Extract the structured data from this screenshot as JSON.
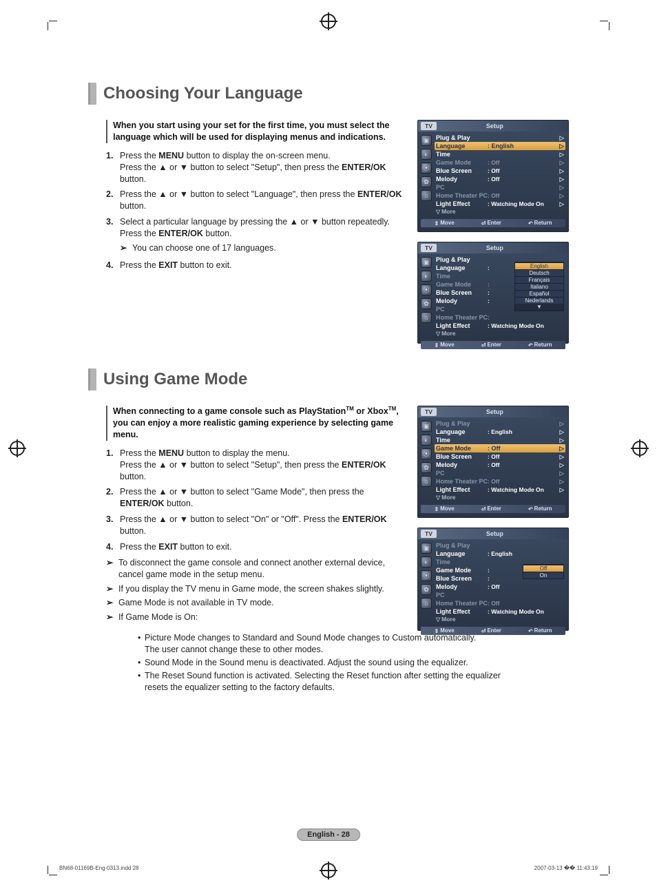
{
  "sec1": {
    "title": "Choosing Your Language",
    "lead": "When you start using your set for the first time, you must select the language which will be used for displaying menus and indications.",
    "steps": {
      "1": {
        "l1": "Press the ",
        "b1": "MENU",
        "l2": " button to display the on-screen menu.",
        "nl": "Press the ▲ or ▼ button to select \"Setup\", then press the ",
        "b2": "ENTER/OK",
        "l3": " button."
      },
      "2": {
        "l1": "Press the ▲ or ▼ button to select \"Language\", then press the ",
        "b1": "ENTER/OK",
        "l2": " button."
      },
      "3": {
        "l1": "Select a particular language by pressing the ▲ or ▼ button repeatedly.",
        "nl": "Press the ",
        "b1": "ENTER/OK",
        "l2": " button.",
        "note": "You can choose one of 17 languages."
      },
      "4": {
        "l1": "Press the ",
        "b1": "EXIT",
        "l2": " button to exit."
      }
    }
  },
  "sec2": {
    "title": "Using Game Mode",
    "lead_a": "When connecting to a game console such as PlayStation",
    "lead_b": " or Xbox",
    "lead_c": ", you can enjoy a more realistic gaming experience by selecting game menu.",
    "tm": "TM",
    "steps": {
      "1": {
        "l1": "Press the ",
        "b1": "MENU",
        "l2": " button to display the menu.",
        "nl": "Press the ▲ or ▼ button to select \"Setup\", then press the ",
        "b2": "ENTER/OK",
        "l3": " button."
      },
      "2": {
        "l1": "Press the ▲ or ▼ button to select \"Game Mode\", then press the ",
        "b1": "ENTER/OK",
        "l2": " button."
      },
      "3": {
        "l1": "Press the ▲ or ▼ button to select \"On\" or \"Off\". Press the ",
        "b1": "ENTER/OK",
        "l2": " button."
      },
      "4": {
        "l1": "Press the ",
        "b1": "EXIT",
        "l2": " button to exit."
      }
    },
    "notes": {
      "n1": "To disconnect the game console and connect another external device, cancel game mode in the setup menu.",
      "n2": "If you display the TV menu in Game mode, the screen shakes slightly.",
      "n3": "Game Mode is not available in TV mode.",
      "n4": "If Game Mode is On:"
    },
    "bullets": {
      "b1a": "Picture Mode changes to Standard and Sound Mode changes to Custom automatically.",
      "b1b": "The user cannot change these to other modes.",
      "b2": "Sound Mode in the Sound menu is deactivated. Adjust the sound using the equalizer.",
      "b3a": "The Reset Sound function is activated. Selecting the Reset function after setting the equalizer",
      "b3b": "resets the equalizer setting to the factory defaults."
    }
  },
  "osd": {
    "tv": "TV",
    "title": "Setup",
    "rows": {
      "plug": "Plug & Play",
      "language": "Language",
      "time": "Time",
      "game": "Game Mode",
      "blue": "Blue Screen",
      "melody": "Melody",
      "pc": "PC",
      "homepc": "Home Theater PC",
      "light": "Light Effect"
    },
    "vals": {
      "english": ": English",
      "off": ": Off",
      "watch": ": Watching Mode On",
      "colon": ":"
    },
    "more": "More",
    "footer": {
      "move": "Move",
      "enter": "Enter",
      "return": "Return"
    },
    "langs": {
      "english": "English",
      "deutsch": "Deutsch",
      "francais": "Français",
      "italiano": "Italiano",
      "espanol": "Español",
      "nederlands": "Nederlands"
    },
    "onoff": {
      "off": "Off",
      "on": "On"
    }
  },
  "footer": {
    "badge": "English - 28",
    "indd": "BN68-01169B-Eng-0313.indd   28",
    "stamp": "2007-03-13   �� 11:43:19"
  }
}
